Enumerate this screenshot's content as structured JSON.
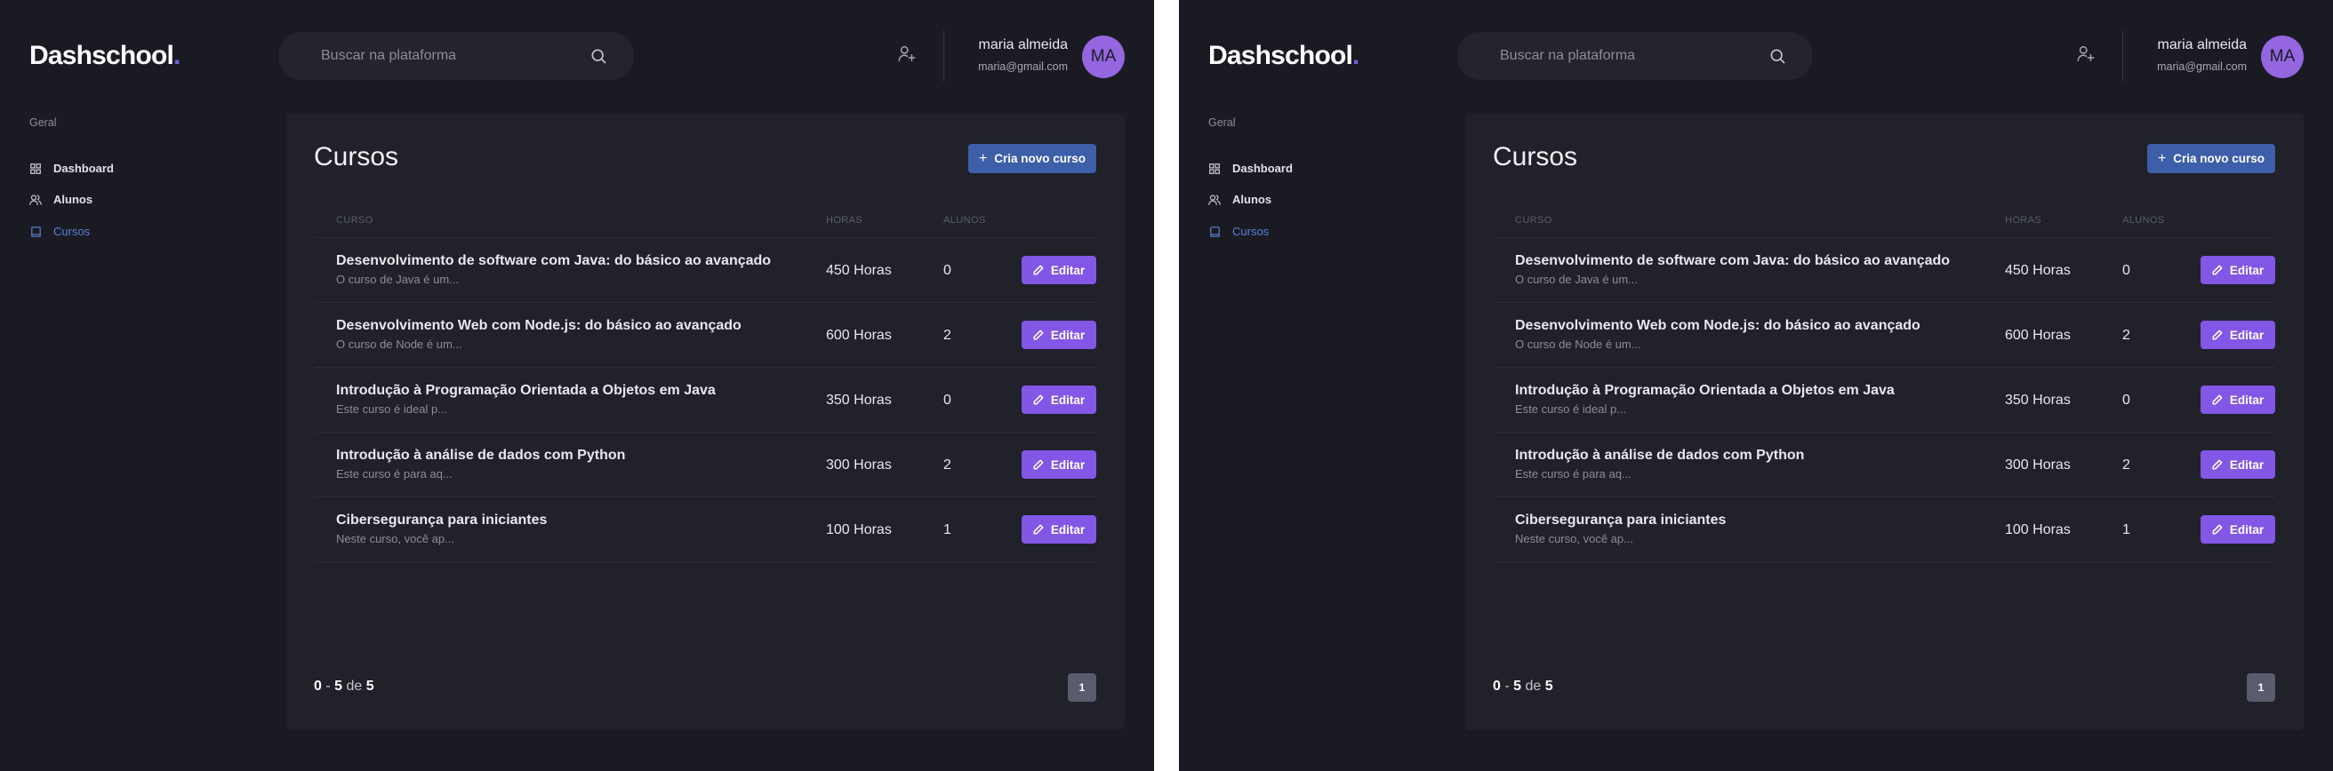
{
  "app": {
    "logo_text": "Dashschool",
    "logo_dot": ".",
    "accent_color": "#6d5fe0"
  },
  "search": {
    "placeholder": "Buscar na plataforma",
    "value": ""
  },
  "user": {
    "name": "maria almeida",
    "email": "maria@gmail.com",
    "initials": "MA",
    "avatar_color": "#9466e0"
  },
  "sidebar": {
    "section_label": "Geral",
    "items": [
      {
        "label": "Dashboard",
        "icon": "dashboard-icon"
      },
      {
        "label": "Alunos",
        "icon": "users-icon"
      },
      {
        "label": "Cursos",
        "icon": "book-icon",
        "active": true
      }
    ]
  },
  "main": {
    "title": "Cursos",
    "new_button_label": "Cria novo curso",
    "table": {
      "headers": {
        "curso": "CURSO",
        "horas": "HORAS",
        "alunos": "ALUNOS"
      },
      "rows": [
        {
          "title": "Desenvolvimento de software com Java: do básico ao avançado",
          "desc": "O curso de Java é um...",
          "horas": "450 Horas",
          "alunos": "0",
          "action": "Editar"
        },
        {
          "title": "Desenvolvimento Web com Node.js: do básico ao avançado",
          "desc": "O curso de Node é um...",
          "horas": "600 Horas",
          "alunos": "2",
          "action": "Editar"
        },
        {
          "title": "Introdução à Programação Orientada a Objetos em Java",
          "desc": "Este curso é ideal p...",
          "horas": "350 Horas",
          "alunos": "0",
          "action": "Editar"
        },
        {
          "title": "Introdução à análise de dados com Python",
          "desc": "Este curso é para aq...",
          "horas": "300 Horas",
          "alunos": "2",
          "action": "Editar"
        },
        {
          "title": "Cibersegurança para iniciantes",
          "desc": "Neste curso, você ap...",
          "horas": "100 Horas",
          "alunos": "1",
          "action": "Editar"
        }
      ]
    },
    "pagination": {
      "start": "0",
      "end": "5",
      "of_label": "de",
      "total": "5",
      "current_page": "1"
    }
  }
}
